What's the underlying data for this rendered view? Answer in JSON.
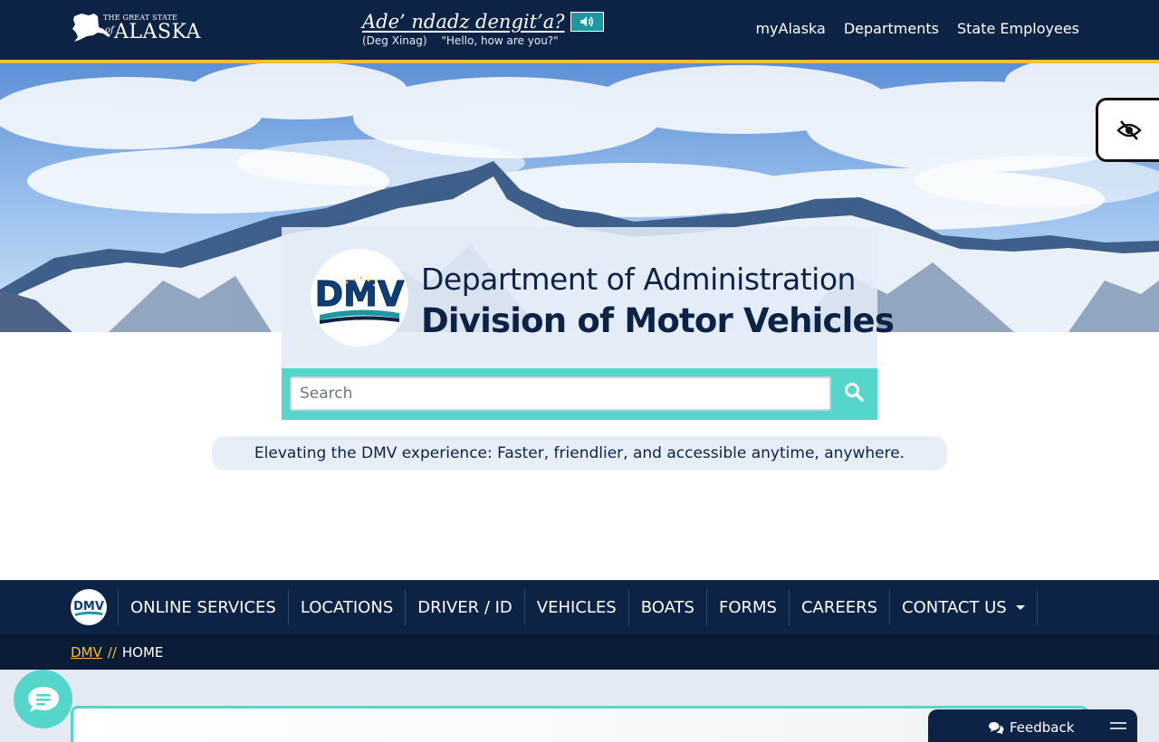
{
  "header": {
    "logo": {
      "line1": "THE GREAT STATE",
      "line2": "of",
      "line3": "ALASKA"
    },
    "phrase": {
      "text": "Ade’ ndadz dengit’a?",
      "language": "(Deg Xinag)",
      "translation": "\"Hello, how are you?\""
    },
    "nav": {
      "item1": "myAlaska",
      "item2": "Departments",
      "item3": "State Employees"
    }
  },
  "brand": {
    "logo_text": "DMV",
    "line1": "Department of Administration",
    "line2": "Division of Motor Vehicles"
  },
  "search": {
    "placeholder": "Search"
  },
  "tagline": "Elevating the DMV experience: Faster, friendlier, and accessible anytime, anywhere.",
  "main_nav": {
    "items": [
      "ONLINE SERVICES",
      "LOCATIONS",
      "DRIVER / ID",
      "VEHICLES",
      "BOATS",
      "FORMS",
      "CAREERS",
      "CONTACT US"
    ]
  },
  "breadcrumb": {
    "link": "DMV",
    "separator": "//",
    "current": "HOME"
  },
  "feedback": {
    "label": "Feedback"
  },
  "colors": {
    "navy": "#0d2346",
    "gold": "#f2c12e",
    "teal": "#55d6cb"
  },
  "icons": [
    "audio-icon",
    "eye-slash-icon",
    "search-icon",
    "chat-icon",
    "comments-icon",
    "menu-icon",
    "caret-down-icon"
  ]
}
